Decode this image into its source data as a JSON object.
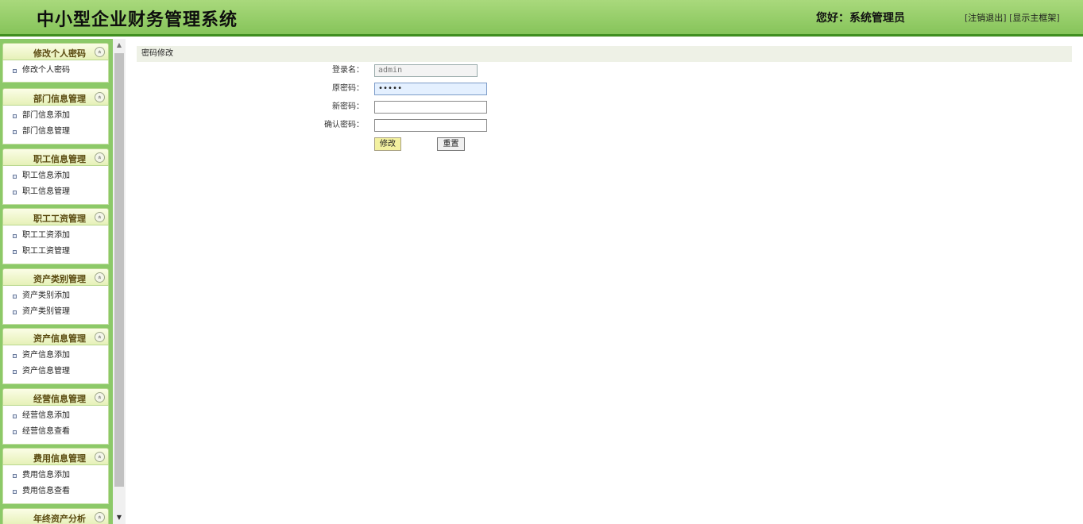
{
  "header": {
    "title": "中小型企业财务管理系统",
    "greeting": "您好：系统管理员",
    "logout": "注销退出",
    "show_frame": "显示主框架",
    "bracket_open": "[",
    "bracket_close": "]"
  },
  "sidebar": {
    "groups": [
      {
        "title": "修改个人密码",
        "items": [
          "修改个人密码"
        ]
      },
      {
        "title": "部门信息管理",
        "items": [
          "部门信息添加",
          "部门信息管理"
        ]
      },
      {
        "title": "职工信息管理",
        "items": [
          "职工信息添加",
          "职工信息管理"
        ]
      },
      {
        "title": "职工工资管理",
        "items": [
          "职工工资添加",
          "职工工资管理"
        ]
      },
      {
        "title": "资产类别管理",
        "items": [
          "资产类别添加",
          "资产类别管理"
        ]
      },
      {
        "title": "资产信息管理",
        "items": [
          "资产信息添加",
          "资产信息管理"
        ]
      },
      {
        "title": "经营信息管理",
        "items": [
          "经营信息添加",
          "经营信息查看"
        ]
      },
      {
        "title": "费用信息管理",
        "items": [
          "费用信息添加",
          "费用信息查看"
        ]
      },
      {
        "title": "年终资产分析",
        "items": []
      }
    ],
    "collapse_symbol": "«"
  },
  "main": {
    "breadcrumb": "密码修改",
    "form": {
      "username_label": "登录名：",
      "username_value": "admin",
      "old_password_label": "原密码：",
      "old_password_value": "•••••",
      "new_password_label": "新密码：",
      "new_password_value": "",
      "confirm_password_label": "确认密码：",
      "confirm_password_value": "",
      "submit_label": "修改",
      "reset_label": "重置"
    }
  },
  "icons": {
    "scroll_up": "▲",
    "scroll_down": "▼"
  },
  "colors": {
    "header_green": "#86c45a",
    "sidebar_green": "#8cc968",
    "header_border": "#3f8e1f"
  }
}
